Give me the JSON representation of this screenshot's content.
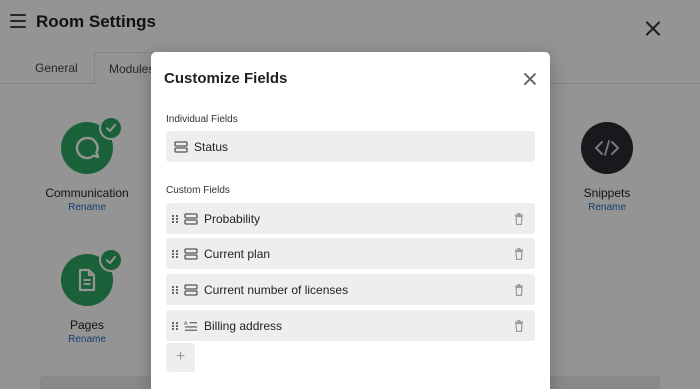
{
  "page": {
    "title": "Room Settings",
    "tabs": [
      {
        "label": "General"
      },
      {
        "label": "Modules"
      }
    ],
    "modules": {
      "communication": {
        "label": "Communication",
        "action": "Rename",
        "icon": "chat-bubble-icon",
        "enabled": true
      },
      "pages": {
        "label": "Pages",
        "action": "Rename",
        "icon": "document-icon",
        "enabled": true
      },
      "snippets": {
        "label": "Snippets",
        "action": "Rename",
        "icon": "code-icon",
        "enabled": false
      }
    }
  },
  "modal": {
    "title": "Customize Fields",
    "individual_section": "Individual Fields",
    "individual_fields": [
      {
        "name": "Status",
        "icon": "field-list-icon"
      }
    ],
    "custom_section": "Custom Fields",
    "custom_fields": [
      {
        "name": "Probability",
        "icon": "field-list-icon"
      },
      {
        "name": "Current plan",
        "icon": "field-list-icon"
      },
      {
        "name": "Current number of licenses",
        "icon": "field-list-icon"
      },
      {
        "name": "Billing address",
        "icon": "text-lines-icon"
      }
    ],
    "add_label": "+"
  },
  "colors": {
    "module_green": "#2ea862",
    "module_dark": "#2b2b33",
    "link_blue": "#2a6bc9",
    "row_bg": "#eeeef1"
  }
}
